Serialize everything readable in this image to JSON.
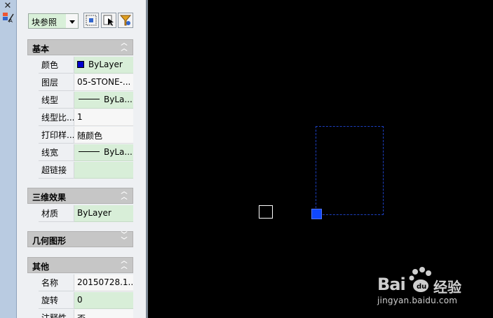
{
  "selector": {
    "value": "块参照"
  },
  "sections": {
    "basic": {
      "title": "基本",
      "rows": [
        {
          "name": "颜色",
          "value": "ByLayer"
        },
        {
          "name": "图层",
          "value": "05-STONE-..."
        },
        {
          "name": "线型",
          "value": "ByLa..."
        },
        {
          "name": "线型比...",
          "value": "1"
        },
        {
          "name": "打印样...",
          "value": "随颜色"
        },
        {
          "name": "线宽",
          "value": "ByLa..."
        },
        {
          "name": "超链接",
          "value": ""
        }
      ]
    },
    "threed": {
      "title": "三维效果",
      "rows": [
        {
          "name": "材质",
          "value": "ByLayer"
        }
      ]
    },
    "geometry": {
      "title": "几何图形"
    },
    "misc": {
      "title": "其他",
      "rows": [
        {
          "name": "名称",
          "value": "20150728.1..."
        },
        {
          "name": "旋转",
          "value": "0"
        },
        {
          "name": "注释性",
          "value": "否"
        }
      ]
    }
  },
  "watermark": {
    "brand": "Bai",
    "cn": "经验",
    "url": "jingyan.baidu.com"
  },
  "colors": {
    "accent_blue": "#1048ff",
    "value_green": "#d8eed8",
    "header_gray": "#c6c6c6"
  }
}
